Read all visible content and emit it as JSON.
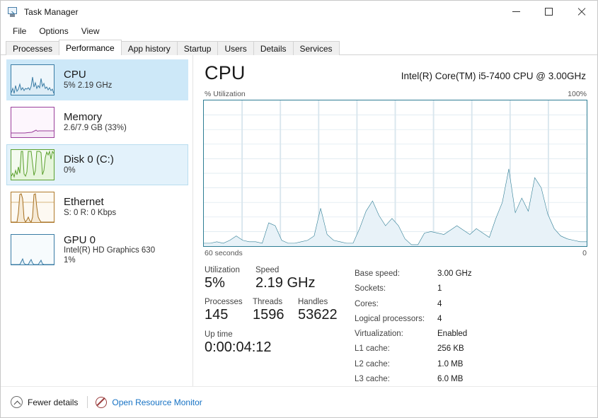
{
  "window": {
    "title": "Task Manager",
    "icon": "task-manager-icon",
    "controls": {
      "minimize": "—",
      "maximize": "☐",
      "close": "✕"
    }
  },
  "menu": {
    "items": [
      "File",
      "Options",
      "View"
    ]
  },
  "tabs": {
    "items": [
      {
        "label": "Processes",
        "active": false
      },
      {
        "label": "Performance",
        "active": true
      },
      {
        "label": "App history",
        "active": false
      },
      {
        "label": "Startup",
        "active": false
      },
      {
        "label": "Users",
        "active": false
      },
      {
        "label": "Details",
        "active": false
      },
      {
        "label": "Services",
        "active": false
      }
    ]
  },
  "sidebar": {
    "items": [
      {
        "title": "CPU",
        "sub": "5% 2.19 GHz",
        "sub2": "",
        "state": "selected",
        "color": "#3a7ca5"
      },
      {
        "title": "Memory",
        "sub": "2.6/7.9 GB (33%)",
        "sub2": "",
        "state": "normal",
        "color": "#9b3f9b"
      },
      {
        "title": "Disk 0 (C:)",
        "sub": "0%",
        "sub2": "",
        "state": "hover",
        "color": "#5aa котор"
      },
      {
        "title": "Ethernet",
        "sub": "S: 0 R: 0 Kbps",
        "sub2": "",
        "state": "normal",
        "color": "#b07a2a"
      },
      {
        "title": "GPU 0",
        "sub": "Intel(R) HD Graphics 630",
        "sub2": "1%",
        "state": "normal",
        "color": "#3a7ca5"
      }
    ]
  },
  "main": {
    "title": "CPU",
    "model": "Intel(R) Core(TM) i5-7400 CPU @ 3.00GHz",
    "axis_top_left": "% Utilization",
    "axis_top_right": "100%",
    "axis_bottom_left": "60 seconds",
    "axis_bottom_right": "0"
  },
  "stats": {
    "utilization_label": "Utilization",
    "utilization_value": "5%",
    "speed_label": "Speed",
    "speed_value": "2.19 GHz",
    "processes_label": "Processes",
    "processes_value": "145",
    "threads_label": "Threads",
    "threads_value": "1596",
    "handles_label": "Handles",
    "handles_value": "53622",
    "uptime_label": "Up time",
    "uptime_value": "0:00:04:12"
  },
  "specs": [
    {
      "key": "Base speed:",
      "value": "3.00 GHz"
    },
    {
      "key": "Sockets:",
      "value": "1"
    },
    {
      "key": "Cores:",
      "value": "4"
    },
    {
      "key": "Logical processors:",
      "value": "4"
    },
    {
      "key": "Virtualization:",
      "value": "Enabled"
    },
    {
      "key": "L1 cache:",
      "value": "256 KB"
    },
    {
      "key": "L2 cache:",
      "value": "1.0 MB"
    },
    {
      "key": "L3 cache:",
      "value": "6.0 MB"
    }
  ],
  "footer": {
    "fewer_details": "Fewer details",
    "open_resource_monitor": "Open Resource Monitor"
  },
  "colors": {
    "accent_blue": "#3a7ca5",
    "graph_line": "#2e7d94",
    "graph_fill": "#e8f2f8",
    "selection": "#cde8f8",
    "link": "#1672c4"
  },
  "chart_data": {
    "type": "area",
    "title": "CPU % Utilization",
    "xlabel": "60 seconds",
    "ylabel": "% Utilization",
    "ylim": [
      0,
      100
    ],
    "xlim": [
      60,
      0
    ],
    "grid": true,
    "series": [
      {
        "name": "CPU utilization",
        "values": [
          2,
          2,
          3,
          2,
          4,
          7,
          4,
          3,
          3,
          2,
          16,
          14,
          4,
          2,
          2,
          3,
          4,
          7,
          26,
          8,
          4,
          3,
          2,
          2,
          12,
          24,
          31,
          21,
          14,
          19,
          14,
          5,
          1,
          1,
          9,
          10,
          9,
          8,
          11,
          14,
          11,
          8,
          12,
          9,
          6,
          19,
          30,
          53,
          23,
          33,
          24,
          47,
          40,
          22,
          12,
          7,
          5,
          4,
          3,
          3
        ]
      }
    ]
  }
}
